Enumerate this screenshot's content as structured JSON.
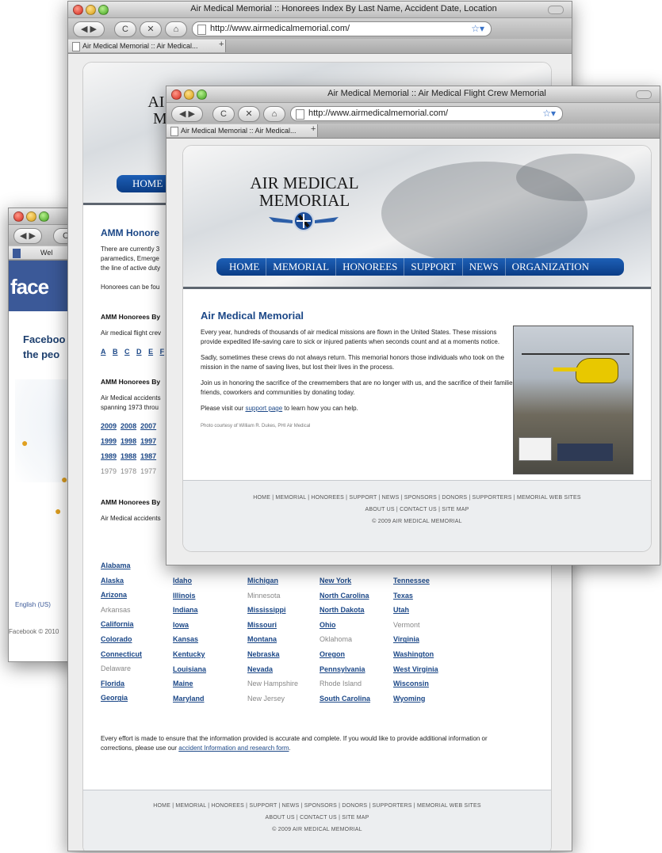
{
  "window_left": {
    "tab_label": "Wel",
    "brand_text": "face",
    "tagline_1": "Faceboo",
    "tagline_2": "the peo",
    "language": "English (US)",
    "copyright": "Facebook © 2010"
  },
  "window_mid": {
    "title": "Air Medical Memorial :: Honorees Index By Last Name, Accident Date, Location",
    "url": "http://www.airmedicalmemorial.com/",
    "tab_label": "Air Medical Memorial :: Air Medical...",
    "logo_partial_1": "AI",
    "logo_partial_2": "M",
    "nav_home": "HOME",
    "heading": "AMM Honore",
    "intro_lines": [
      "There are currently 3",
      "paramedics, Emerge",
      "the line of active duty"
    ],
    "honorees_line": "Honorees can be fou",
    "section1_title": "AMM Honorees By",
    "section1_text": "Air medical flight crev",
    "letters": [
      "A",
      "B",
      "C",
      "D",
      "E",
      "F"
    ],
    "section2_title": "AMM Honorees By",
    "section2_lines": [
      "Air Medical accidents",
      "spanning 1973 throu"
    ],
    "years_row1": [
      "2009",
      "2008",
      "2007"
    ],
    "years_row2": [
      "1999",
      "1998",
      "1997"
    ],
    "years_row3": [
      "1989",
      "1988",
      "1987"
    ],
    "years_row4": [
      "1979",
      "1978",
      "1977"
    ],
    "section3_title": "AMM Honorees By",
    "section3_text": "Air Medical accidents",
    "states": {
      "col1": [
        {
          "name": "Alabama",
          "link": true
        },
        {
          "name": "Alaska",
          "link": true
        },
        {
          "name": "Arizona",
          "link": true
        },
        {
          "name": "Arkansas",
          "link": false
        },
        {
          "name": "California",
          "link": true
        },
        {
          "name": "Colorado",
          "link": true
        },
        {
          "name": "Connecticut",
          "link": true
        },
        {
          "name": "Delaware",
          "link": false
        },
        {
          "name": "Florida",
          "link": true
        },
        {
          "name": "Georgia",
          "link": true
        }
      ],
      "col2": [
        {
          "name": "Idaho",
          "link": true
        },
        {
          "name": "Illinois",
          "link": true
        },
        {
          "name": "Indiana",
          "link": true
        },
        {
          "name": "Iowa",
          "link": true
        },
        {
          "name": "Kansas",
          "link": true
        },
        {
          "name": "Kentucky",
          "link": true
        },
        {
          "name": "Louisiana",
          "link": true
        },
        {
          "name": "Maine",
          "link": true
        },
        {
          "name": "Maryland",
          "link": true
        }
      ],
      "col3": [
        {
          "name": "Michigan",
          "link": true
        },
        {
          "name": "Minnesota",
          "link": false
        },
        {
          "name": "Mississippi",
          "link": true
        },
        {
          "name": "Missouri",
          "link": true
        },
        {
          "name": "Montana",
          "link": true
        },
        {
          "name": "Nebraska",
          "link": true
        },
        {
          "name": "Nevada",
          "link": true
        },
        {
          "name": "New Hampshire",
          "link": false
        },
        {
          "name": "New Jersey",
          "link": false
        }
      ],
      "col4": [
        {
          "name": "New York",
          "link": true
        },
        {
          "name": "North Carolina",
          "link": true
        },
        {
          "name": "North Dakota",
          "link": true
        },
        {
          "name": "Ohio",
          "link": true
        },
        {
          "name": "Oklahoma",
          "link": false
        },
        {
          "name": "Oregon",
          "link": true
        },
        {
          "name": "Pennsylvania",
          "link": true
        },
        {
          "name": "Rhode Island",
          "link": false
        },
        {
          "name": "South Carolina",
          "link": true
        }
      ],
      "col5": [
        {
          "name": "Tennessee",
          "link": true
        },
        {
          "name": "Texas",
          "link": true
        },
        {
          "name": "Utah",
          "link": true
        },
        {
          "name": "Vermont",
          "link": false
        },
        {
          "name": "Virginia",
          "link": true
        },
        {
          "name": "Washington",
          "link": true
        },
        {
          "name": "West Virginia",
          "link": true
        },
        {
          "name": "Wisconsin",
          "link": true
        },
        {
          "name": "Wyoming",
          "link": true
        }
      ]
    },
    "closing_1": "Every effort is made to ensure that the information provided is accurate and complete. If you would like to provide additional information or",
    "closing_2_pre": "corrections, please use our ",
    "closing_link": "accident Information and research form",
    "closing_2_post": ".",
    "footer_row1": "HOME | MEMORIAL | HONOREES | SUPPORT | NEWS | SPONSORS | DONORS | SUPPORTERS | MEMORIAL WEB SITES",
    "footer_row2": "ABOUT US | CONTACT US | SITE MAP",
    "footer_row3": "© 2009 AIR MEDICAL MEMORIAL"
  },
  "window_front": {
    "title": "Air Medical Memorial :: Air Medical Flight Crew Memorial",
    "url": "http://www.airmedicalmemorial.com/",
    "tab_label": "Air Medical Memorial :: Air Medical...",
    "logo_line1": "AIR MEDICAL",
    "logo_line2": "MEMORIAL",
    "nav": [
      "HOME",
      "MEMORIAL",
      "HONOREES",
      "SUPPORT",
      "NEWS",
      "ORGANIZATION"
    ],
    "heading": "Air Medical Memorial",
    "para1": "Every year, hundreds of thousands of air medical missions are flown in the United States. These missions provide expedited life-saving care to sick or injured patients when seconds count and at a moments notice.",
    "para2": "Sadly, sometimes these crews do not always return. This memorial honors those individuals who took on the mission in the name of saving lives, but lost their lives in the process.",
    "para3": "Join us in honoring the sacrifice of the crewmembers that are no longer with us, and the sacrifice of their families, friends, coworkers and communities by donating today.",
    "para4_pre": "Please visit our ",
    "para4_link": "support page",
    "para4_post": " to learn how you can help.",
    "photo_credit": "Photo courtesy of William R. Dukes, PHI Air Medical",
    "footer_row1": "HOME | MEMORIAL | HONOREES | SUPPORT | NEWS | SPONSORS | DONORS | SUPPORTERS | MEMORIAL WEB SITES",
    "footer_row2": "ABOUT US | CONTACT US | SITE MAP",
    "footer_row3": "© 2009 AIR MEDICAL MEMORIAL"
  },
  "colors": {
    "accent_blue": "#1b4787",
    "nav_blue": "#0b3d86",
    "facebook_blue": "#3b5998",
    "helicopter_yellow": "#e8c800"
  }
}
